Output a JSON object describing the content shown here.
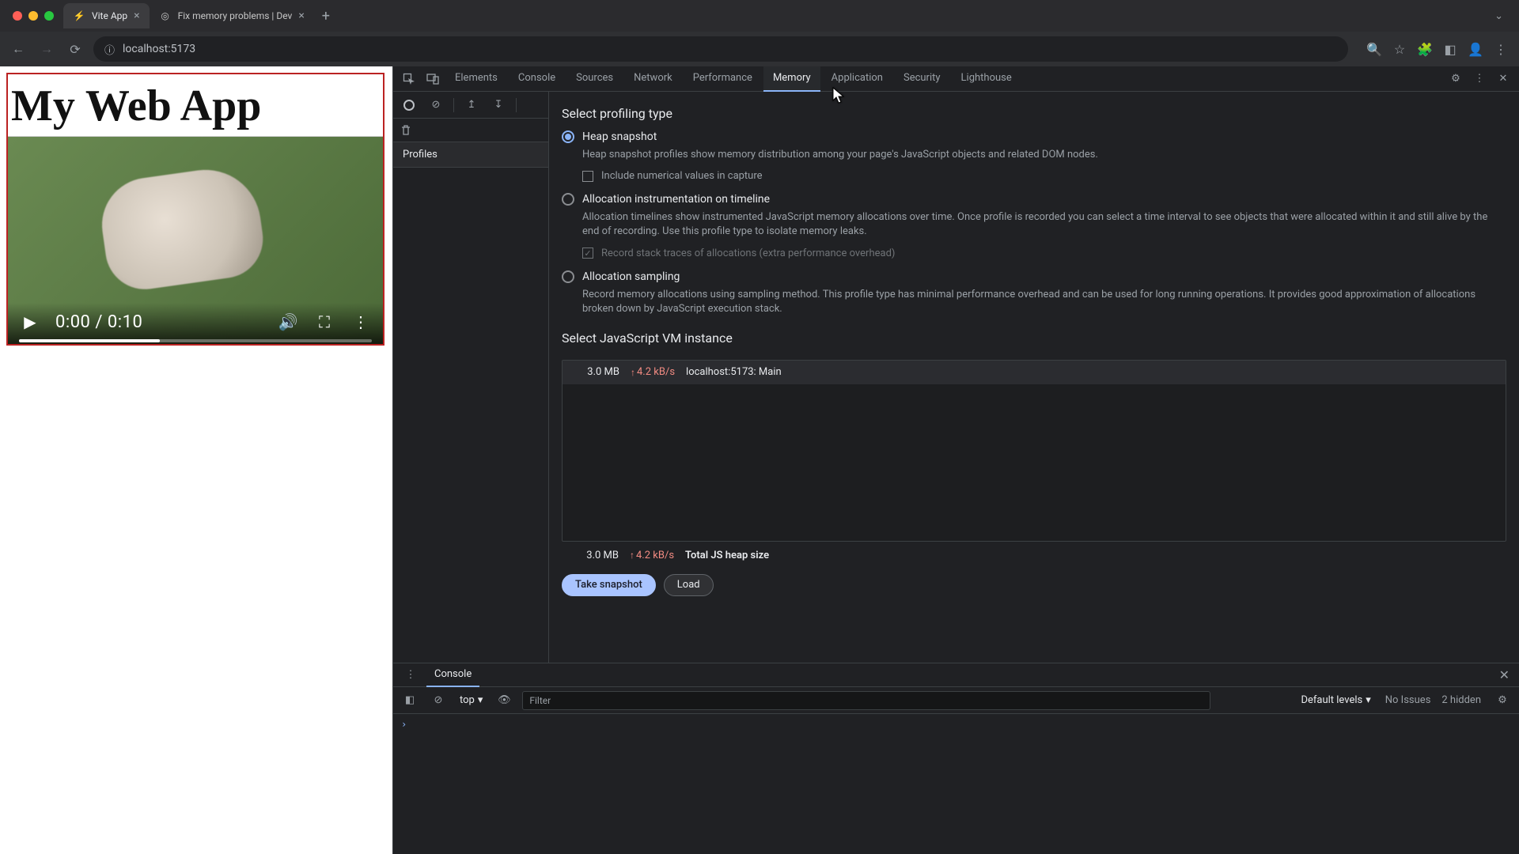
{
  "browser": {
    "tabs": [
      {
        "title": "Vite App",
        "favicon": "⚡",
        "active": true
      },
      {
        "title": "Fix memory problems | Dev",
        "favicon": "◎",
        "active": false
      }
    ],
    "url": "localhost:5173"
  },
  "page": {
    "heading": "My Web App",
    "video": {
      "current": "0:00",
      "duration": "0:10"
    }
  },
  "devtools": {
    "tabs": [
      "Elements",
      "Console",
      "Sources",
      "Network",
      "Performance",
      "Memory",
      "Application",
      "Security",
      "Lighthouse"
    ],
    "active_tab": "Memory",
    "sidebar": {
      "heading": "Profiles"
    },
    "memory": {
      "select_type_title": "Select profiling type",
      "options": [
        {
          "id": "heap",
          "label": "Heap snapshot",
          "checked": true,
          "desc": "Heap snapshot profiles show memory distribution among your page's JavaScript objects and related DOM nodes.",
          "checkbox": {
            "label": "Include numerical values in capture",
            "checked": false,
            "muted": false
          }
        },
        {
          "id": "timeline",
          "label": "Allocation instrumentation on timeline",
          "checked": false,
          "desc": "Allocation timelines show instrumented JavaScript memory allocations over time. Once profile is recorded you can select a time interval to see objects that were allocated within it and still alive by the end of recording. Use this profile type to isolate memory leaks.",
          "checkbox": {
            "label": "Record stack traces of allocations (extra performance overhead)",
            "checked": true,
            "muted": true
          }
        },
        {
          "id": "sampling",
          "label": "Allocation sampling",
          "checked": false,
          "desc": "Record memory allocations using sampling method. This profile type has minimal performance overhead and can be used for long running operations. It provides good approximation of allocations broken down by JavaScript execution stack."
        }
      ],
      "vm_title": "Select JavaScript VM instance",
      "vm": {
        "size": "3.0 MB",
        "rate": "4.2 kB/s",
        "name": "localhost:5173: Main"
      },
      "total": {
        "size": "3.0 MB",
        "rate": "4.2 kB/s",
        "label": "Total JS heap size"
      },
      "buttons": {
        "primary": "Take snapshot",
        "secondary": "Load"
      }
    },
    "console": {
      "tab_label": "Console",
      "context": "top",
      "filter_placeholder": "Filter",
      "levels": "Default levels",
      "issues": "No Issues",
      "hidden": "2 hidden"
    }
  }
}
